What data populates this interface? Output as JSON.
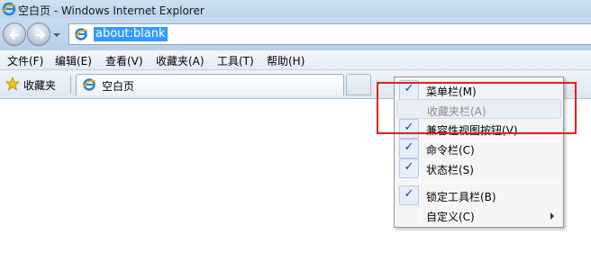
{
  "window": {
    "title": "空白页 - Windows Internet Explorer"
  },
  "address": {
    "url": "about:blank"
  },
  "menubar": {
    "items": [
      "文件(F)",
      "编辑(E)",
      "查看(V)",
      "收藏夹(A)",
      "工具(T)",
      "帮助(H)"
    ]
  },
  "favorites_bar": {
    "favorites_label": "收藏夹",
    "tab_label": "空白页"
  },
  "context_menu": {
    "items": [
      {
        "label": "菜单栏(M)",
        "checked": true,
        "disabled": false
      },
      {
        "label": "收藏夹栏(A)",
        "checked": false,
        "disabled": true
      },
      {
        "label": "兼容性视图按钮(V)",
        "checked": true,
        "disabled": false
      },
      {
        "label": "命令栏(C)",
        "checked": true,
        "disabled": false
      },
      {
        "label": "状态栏(S)",
        "checked": true,
        "disabled": false
      },
      {
        "label": "锁定工具栏(B)",
        "checked": true,
        "disabled": false
      },
      {
        "label": "自定义(C)",
        "checked": false,
        "disabled": false,
        "submenu": true
      }
    ],
    "check_mark": "✓"
  },
  "colors": {
    "accent_blue": "#3399ff",
    "highlight_red": "#e02020"
  },
  "icons": {
    "browser": "ie-icon",
    "favorites": "star-icon",
    "page": "page-icon"
  }
}
